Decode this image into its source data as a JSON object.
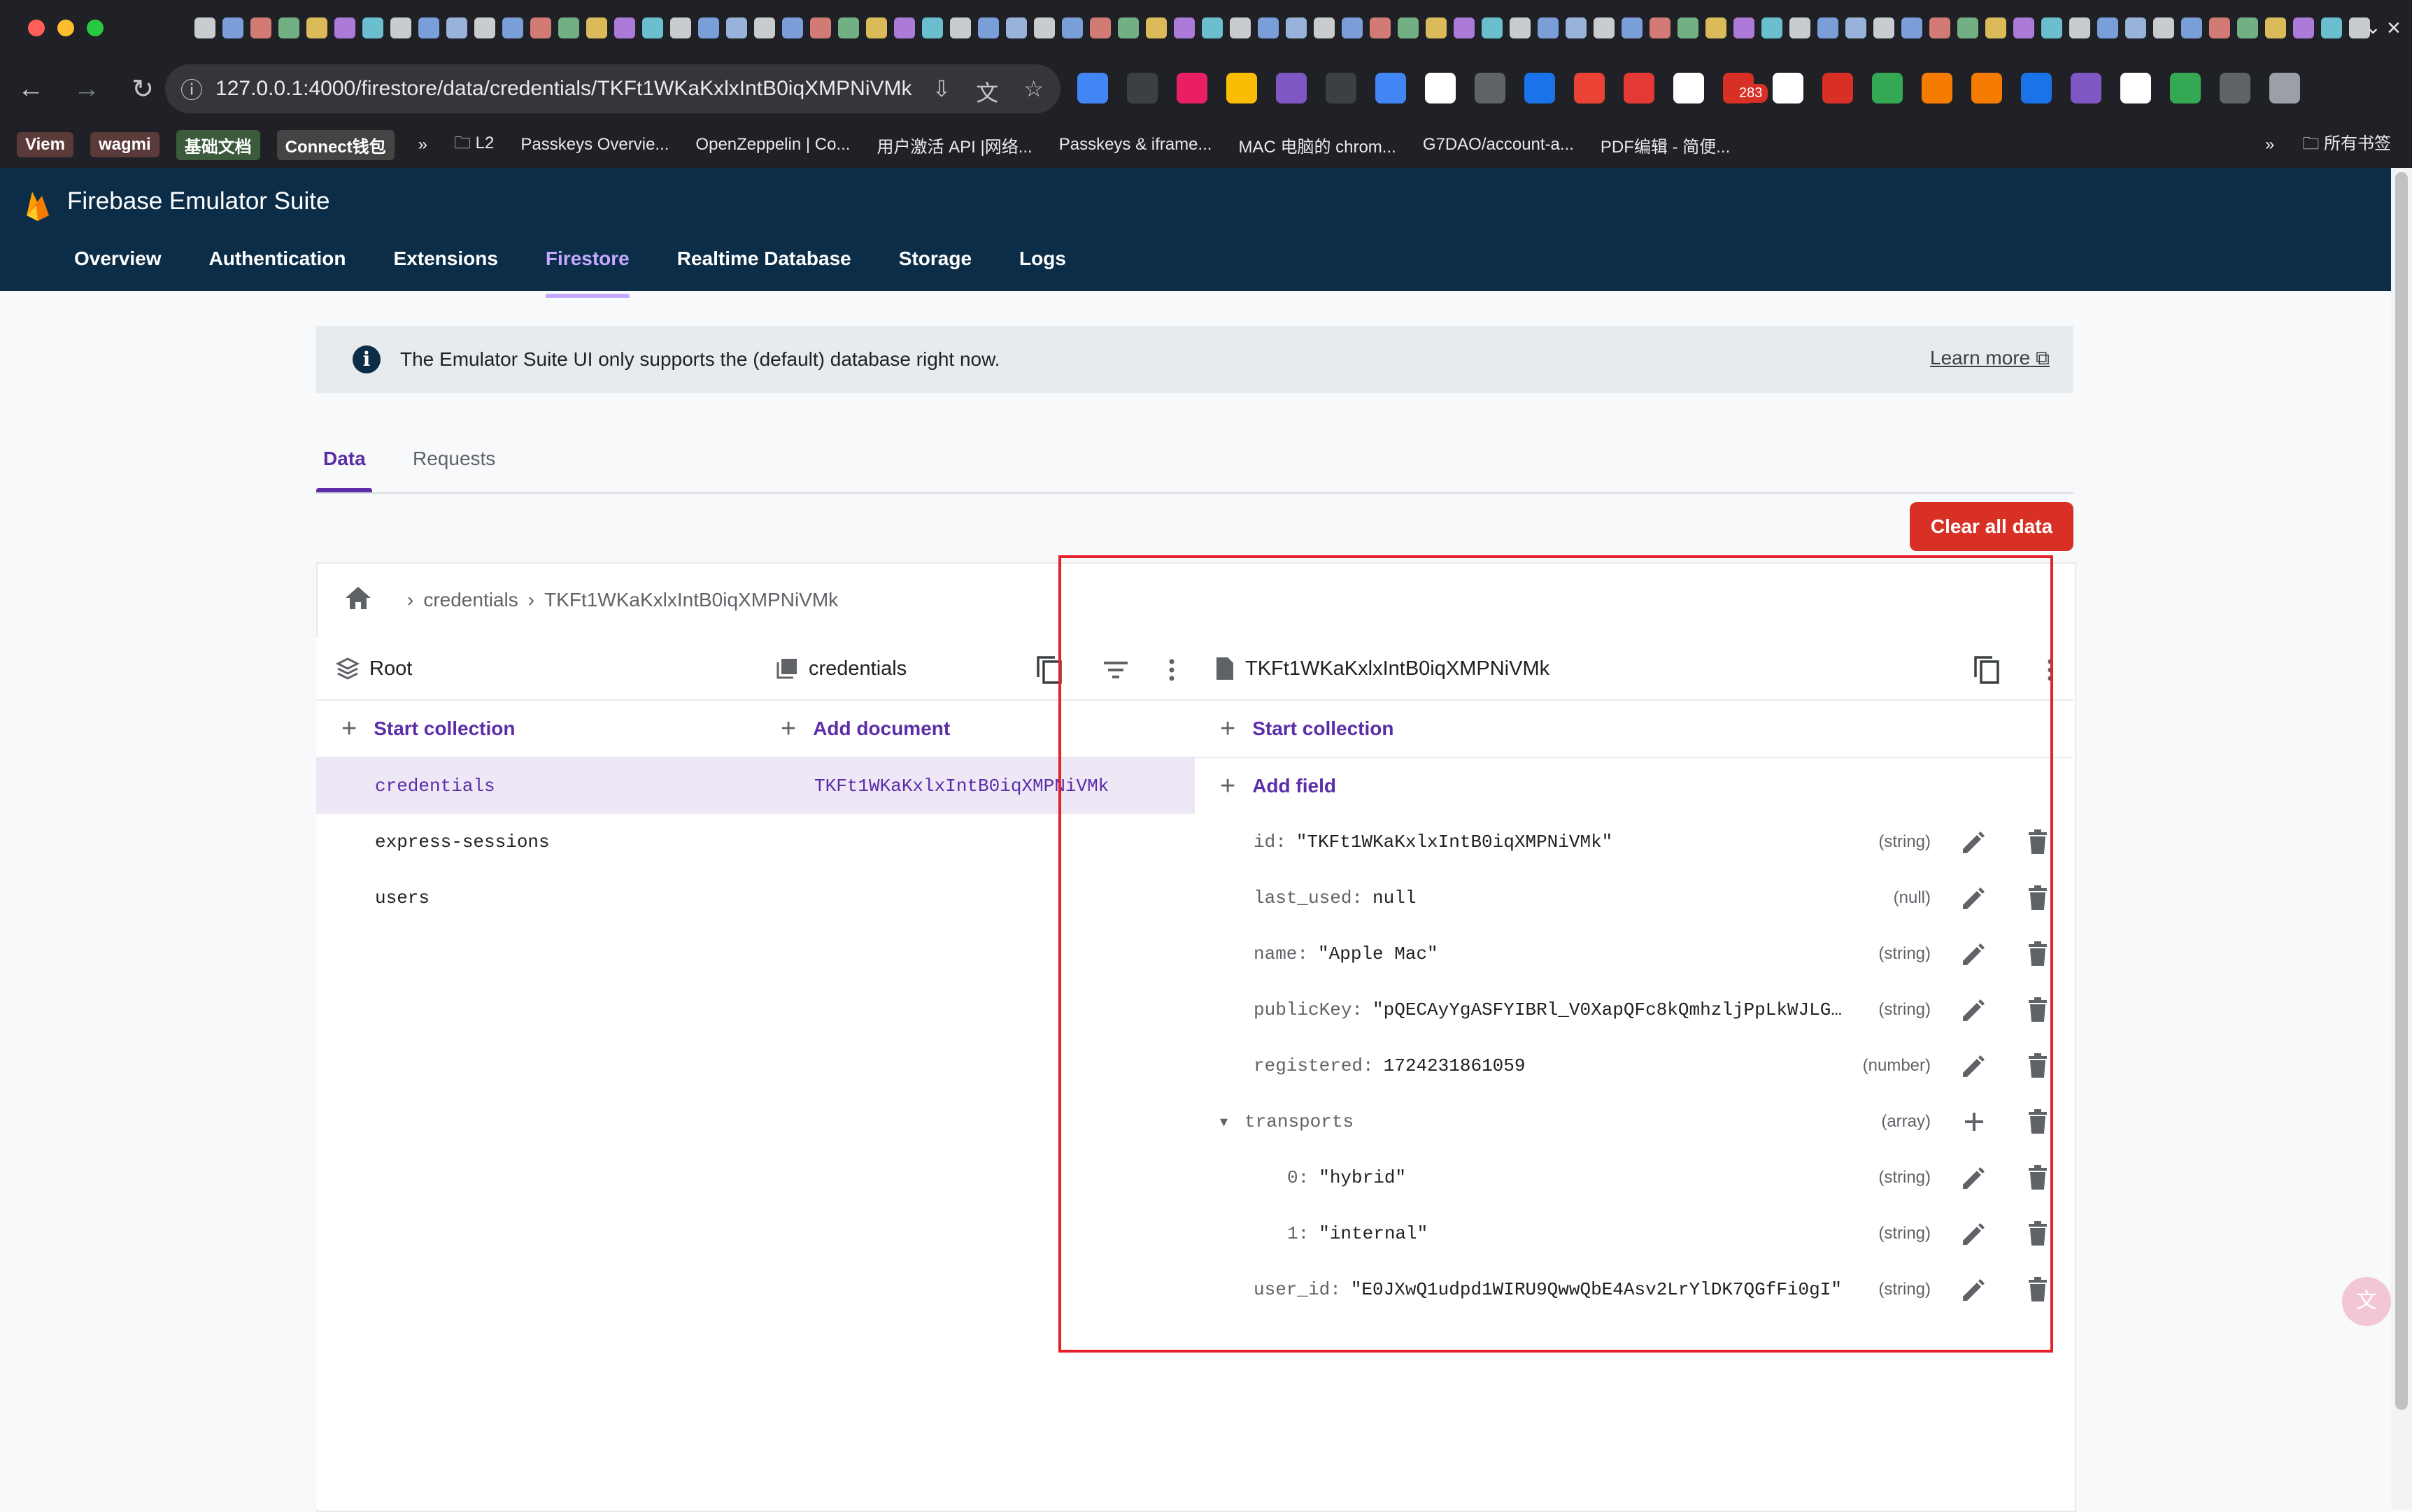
{
  "browser": {
    "url": "127.0.0.1:4000/firestore/data/credentials/TKFt1WKaKxlxIntB0iqXMPNiVMk",
    "extension_badge": "283",
    "bookmarks": {
      "chips": [
        "Viem",
        "wagmi",
        "基础文档",
        "Connect钱包"
      ],
      "overflow_left": "»",
      "items": [
        "L2",
        "Passkeys Overvie...",
        "OpenZeppelin | Co...",
        "用户激活 API |网络...",
        "Passkeys & iframe...",
        "MAC 电脑的 chrom...",
        "G7DAO/account-a...",
        "PDF编辑 - 简便..."
      ],
      "overflow_right": "»",
      "all_bookmarks": "所有书签"
    }
  },
  "app": {
    "title": "Firebase Emulator Suite",
    "nav": [
      "Overview",
      "Authentication",
      "Extensions",
      "Firestore",
      "Realtime Database",
      "Storage",
      "Logs"
    ],
    "active_nav": "Firestore"
  },
  "banner": {
    "text": "The Emulator Suite UI only supports the (default) database right now.",
    "link": "Learn more"
  },
  "subtabs": [
    "Data",
    "Requests"
  ],
  "clear_button": "Clear all data",
  "breadcrumb": [
    "credentials",
    "TKFt1WKaKxlxIntB0iqXMPNiVMk"
  ],
  "root_column": {
    "title": "Root",
    "action": "Start collection",
    "collections": [
      "credentials",
      "express-sessions",
      "users"
    ]
  },
  "collection_column": {
    "title": "credentials",
    "action": "Add document",
    "documents": [
      "TKFt1WKaKxlxIntB0iqXMPNiVMk"
    ]
  },
  "document_column": {
    "title": "TKFt1WKaKxlxIntB0iqXMPNiVMk",
    "start_collection": "Start collection",
    "add_field": "Add field",
    "fields": [
      {
        "key": "id:",
        "value": "\"TKFt1WKaKxlxIntB0iqXMPNiVMk\"",
        "type": "(string)"
      },
      {
        "key": "last_used:",
        "value": "null",
        "type": "(null)"
      },
      {
        "key": "name:",
        "value": "\"Apple Mac\"",
        "type": "(string)"
      },
      {
        "key": "publicKey:",
        "value": "\"pQECAyYgASFYIBRl_V0XapQFc8kQmhzljPpLkWJLG…",
        "type": "(string)"
      },
      {
        "key": "registered:",
        "value": "1724231861059",
        "type": "(number)"
      },
      {
        "key": "transports",
        "value": "",
        "type": "(array)"
      },
      {
        "key": "0:",
        "value": "\"hybrid\"",
        "type": "(string)"
      },
      {
        "key": "1:",
        "value": "\"internal\"",
        "type": "(string)"
      },
      {
        "key": "user_id:",
        "value": "\"E0JXwQ1udpd1WIRU9QwwQbE4Asv2LrYlDK7QGfFi0gI\"",
        "type": "(string)"
      }
    ]
  },
  "colors": {
    "header_bg": "#0b2d48",
    "accent": "#5b2ea8",
    "danger": "#d93025",
    "highlight_box": "#e8202a"
  }
}
